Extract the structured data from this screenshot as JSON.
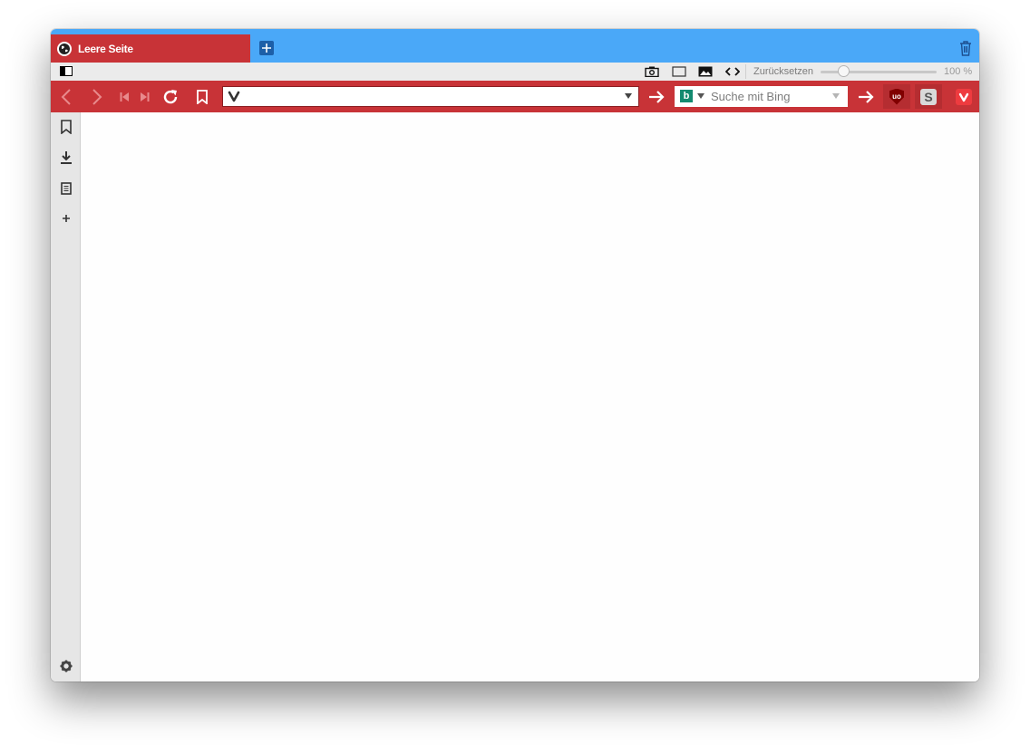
{
  "tabs": [
    {
      "title": "Leere Seite",
      "active": true
    }
  ],
  "address_bar": {
    "url_value": "",
    "search_placeholder": "Suche mit Bing",
    "search_engine": "Bing"
  },
  "status_bar": {
    "zoom_reset_label": "Zurücksetzen",
    "zoom_value": "100 %",
    "zoom_level": 100
  },
  "colors": {
    "tab_bar": "#4aa8f8",
    "accent": "#c83337",
    "bing": "#138a70"
  },
  "icons": {
    "tab_favicon": "globe-icon",
    "new_tab": "plus-icon",
    "trash": "trash-icon",
    "nav": [
      "back-icon",
      "forward-icon",
      "rewind-icon",
      "fast-forward-icon",
      "reload-icon",
      "bookmark-icon"
    ],
    "sidebar": [
      "bookmarks-icon",
      "downloads-icon",
      "notes-icon",
      "add-panel-icon",
      "settings-icon"
    ],
    "extensions": [
      "ublock-icon",
      "s-extension-icon"
    ]
  }
}
